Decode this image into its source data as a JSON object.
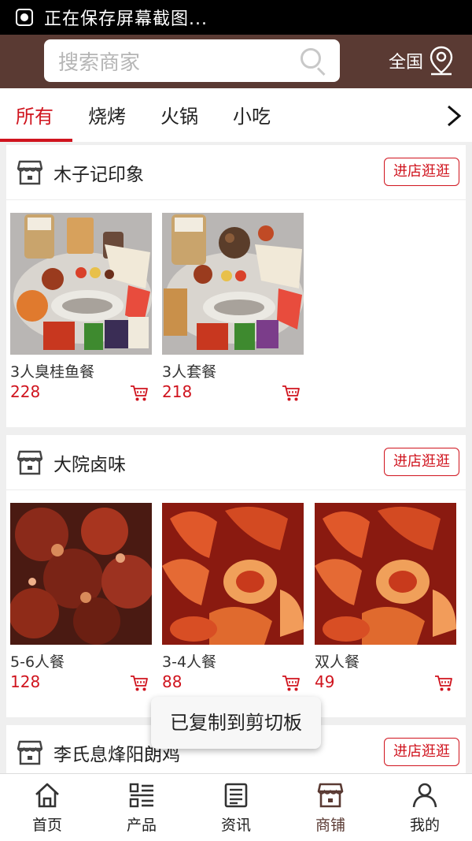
{
  "status_bar": {
    "text": "正在保存屏幕截图...",
    "icon": "screenshot-icon"
  },
  "header": {
    "search_placeholder": "搜索商家",
    "region_label": "全国",
    "search_icon": "search-icon",
    "location_icon": "location-pin-icon"
  },
  "tabs": [
    {
      "label": "所有",
      "active": true
    },
    {
      "label": "烧烤",
      "active": false
    },
    {
      "label": "火锅",
      "active": false
    },
    {
      "label": "小吃",
      "active": false
    }
  ],
  "shops": [
    {
      "name": "木子记印象",
      "visit_label": "进店逛逛",
      "products": [
        {
          "name": "3人臭桂鱼餐",
          "price": "228"
        },
        {
          "name": "3人套餐",
          "price": "218"
        }
      ]
    },
    {
      "name": "大院卤味",
      "visit_label": "进店逛逛",
      "products": [
        {
          "name": "5-6人餐",
          "price": "128"
        },
        {
          "name": "3-4人餐",
          "price": "88"
        },
        {
          "name": "双人餐",
          "price": "49"
        }
      ]
    },
    {
      "name": "李氏息烽阳朗鸡",
      "visit_label": "进店逛逛"
    }
  ],
  "toast": {
    "text": "已复制到剪切板"
  },
  "bottom_nav": [
    {
      "label": "首页",
      "icon": "home-icon"
    },
    {
      "label": "产品",
      "icon": "list-icon"
    },
    {
      "label": "资讯",
      "icon": "news-icon"
    },
    {
      "label": "商铺",
      "icon": "shop-icon",
      "active": true
    },
    {
      "label": "我的",
      "icon": "user-icon"
    }
  ],
  "colors": {
    "brand_brown": "#5a3a33",
    "accent_red": "#d0141e"
  }
}
